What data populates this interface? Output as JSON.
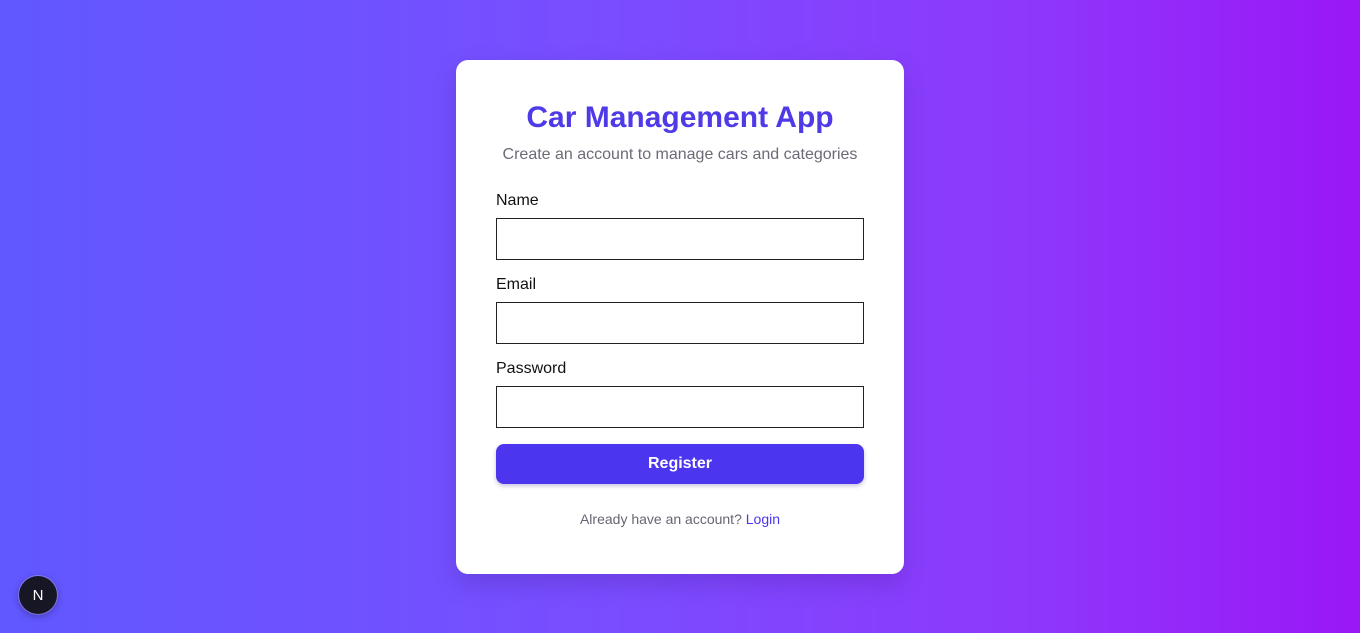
{
  "app": {
    "title": "Car Management App",
    "subtitle": "Create an account to manage cars and categories"
  },
  "form": {
    "fields": [
      {
        "label": "Name",
        "value": "",
        "placeholder": ""
      },
      {
        "label": "Email",
        "value": "",
        "placeholder": ""
      },
      {
        "label": "Password",
        "value": "",
        "placeholder": ""
      }
    ],
    "submit_label": "Register"
  },
  "footer": {
    "prompt": "Already have an account?",
    "link_label": "Login"
  },
  "dev_badge": {
    "letter": "N",
    "icon": "nextjs-logo-icon"
  },
  "colors": {
    "accent": "#4b35ee",
    "title": "#4f3ae8",
    "gradient_start": "#6158ff",
    "gradient_end": "#9a17f6"
  }
}
